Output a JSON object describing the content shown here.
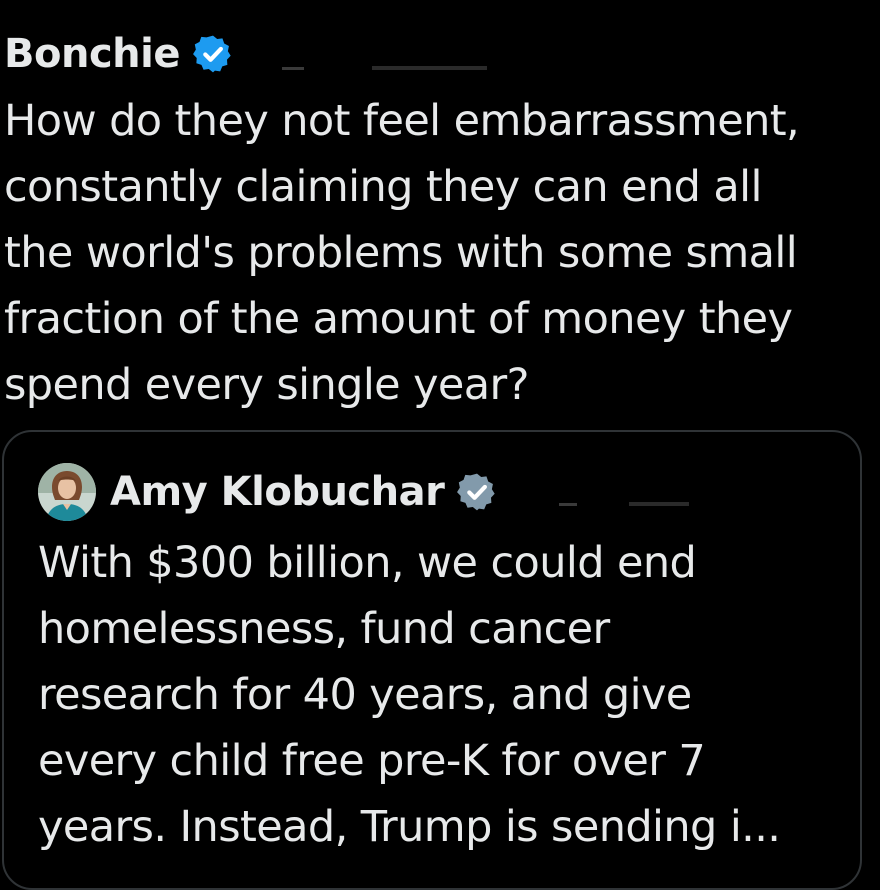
{
  "tweet": {
    "author_name": "Bonchie",
    "verified_icon": "verified-badge-icon",
    "text_lines": [
      "How do they not feel embarrassment,",
      "constantly claiming they can end all",
      "the world's problems with some small",
      "fraction of the amount of money they",
      "spend every single year?"
    ]
  },
  "quoted_tweet": {
    "author_name": "Amy Klobuchar",
    "verified_icon": "government-verified-badge-icon",
    "text_lines": [
      "With $300 billion, we could end",
      "homelessness, fund cancer",
      "research for 40 years, and give",
      "every child free pre-K for over 7",
      "years. Instead, Trump is sending i..."
    ]
  },
  "colors": {
    "background": "#000000",
    "text": "#e7e9ea",
    "verified_blue": "#1d9bf0",
    "government_gray": "#829aab",
    "card_border": "#2f3336"
  }
}
